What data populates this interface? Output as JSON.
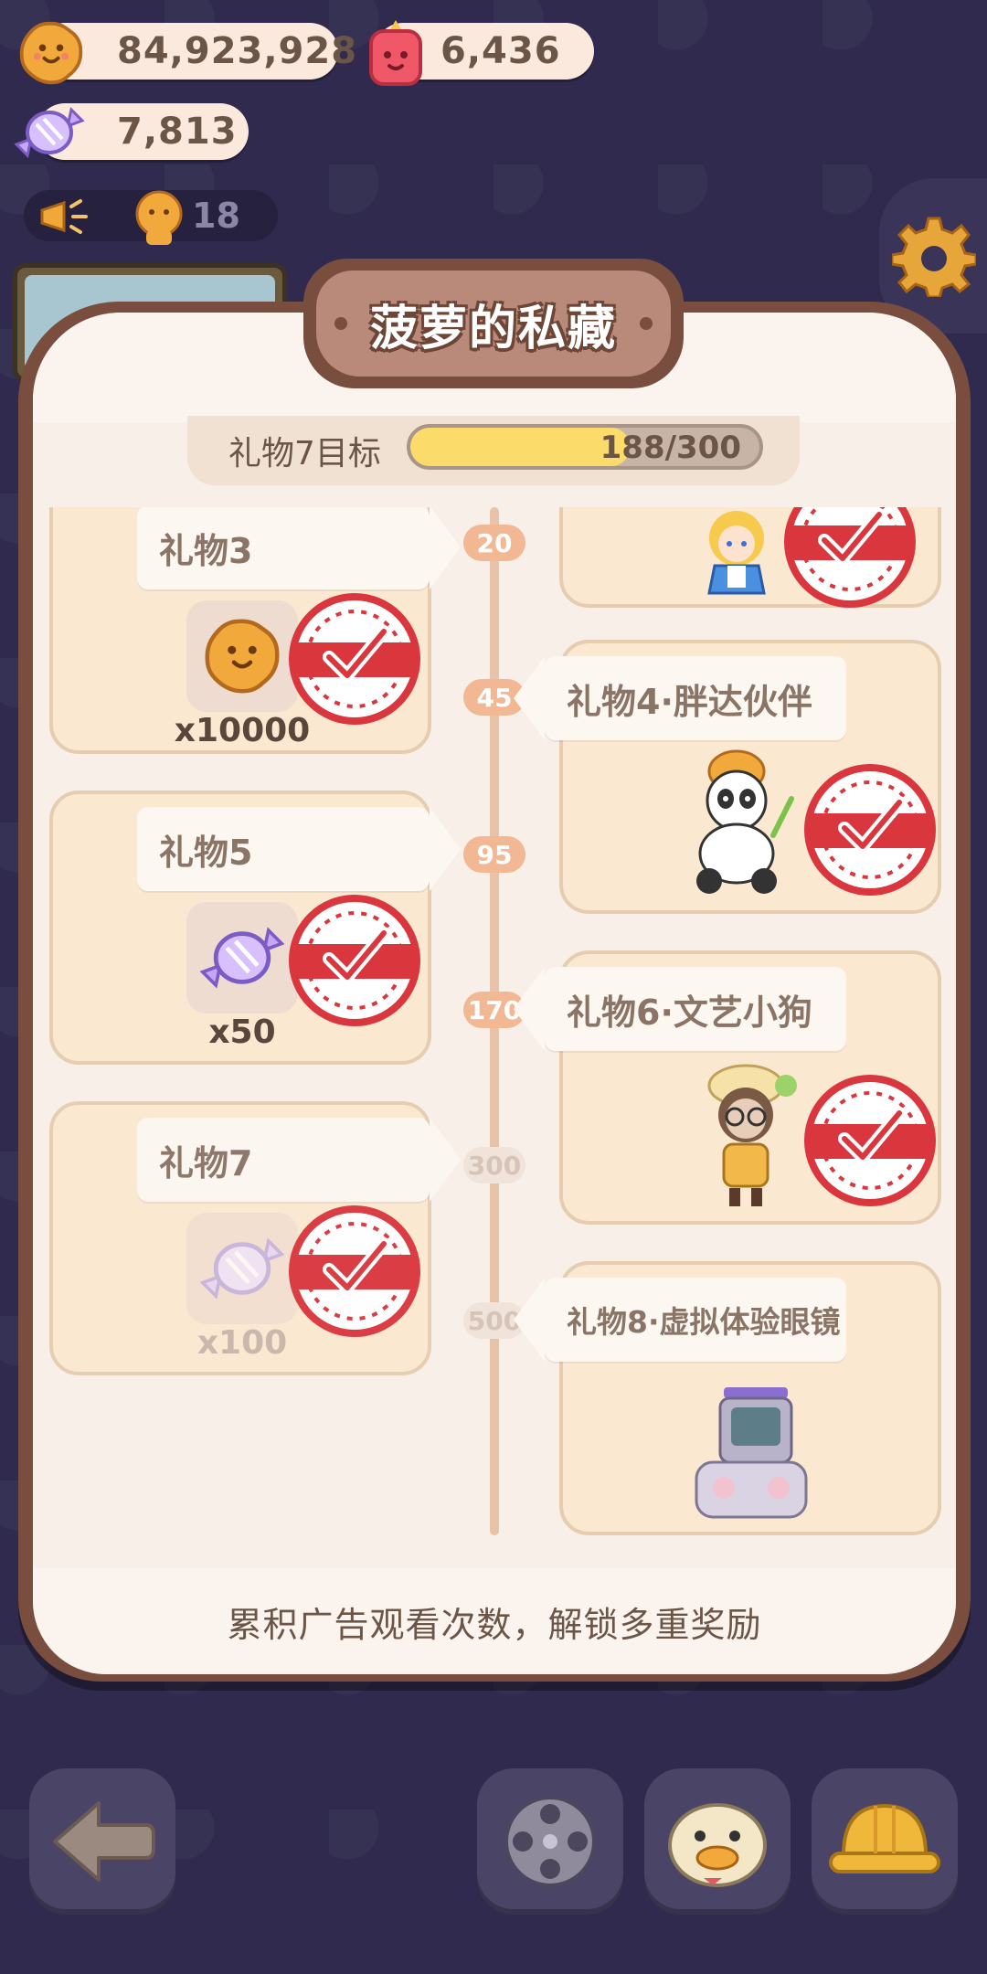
{
  "resources": {
    "coins": "84,923,928",
    "candle": "6,436",
    "candy": "7,813",
    "ad_count": "18"
  },
  "panel": {
    "title": "菠萝的私藏",
    "goal_label": "礼物7目标",
    "progress_text": "188/300",
    "progress_fraction": 0.627,
    "footer": "累积广告观看次数，解锁多重奖励"
  },
  "milestones": [
    "20",
    "45",
    "95",
    "170",
    "300",
    "500"
  ],
  "left_cards": [
    {
      "label": "礼物3",
      "qty": "x10000",
      "item_icon": "cookie-icon",
      "claimed": true
    },
    {
      "label": "礼物5",
      "qty": "x50",
      "item_icon": "candy-icon",
      "claimed": true
    },
    {
      "label": "礼物7",
      "qty": "x100",
      "item_icon": "candy-icon",
      "claimed": true
    }
  ],
  "right_cards": [
    {
      "label": "",
      "item_icon": "doll-character",
      "claimed": true
    },
    {
      "label": "礼物4·胖达伙伴",
      "item_icon": "panda-character",
      "claimed": true
    },
    {
      "label": "礼物6·文艺小狗",
      "item_icon": "dog-character",
      "claimed": true
    },
    {
      "label": "礼物8·虚拟体验眼镜",
      "item_icon": "vr-machine",
      "claimed": false
    }
  ],
  "bottom_buttons": [
    "back-arrow-icon",
    "film-reel-icon",
    "duck-icon",
    "hard-hat-icon"
  ],
  "colors": {
    "background": "#2f2a4e",
    "panel_border": "#7a4e3e",
    "card": "#fbe8d1",
    "progress_fill": "#fbdb6a",
    "stamp_red": "#d9363e"
  }
}
